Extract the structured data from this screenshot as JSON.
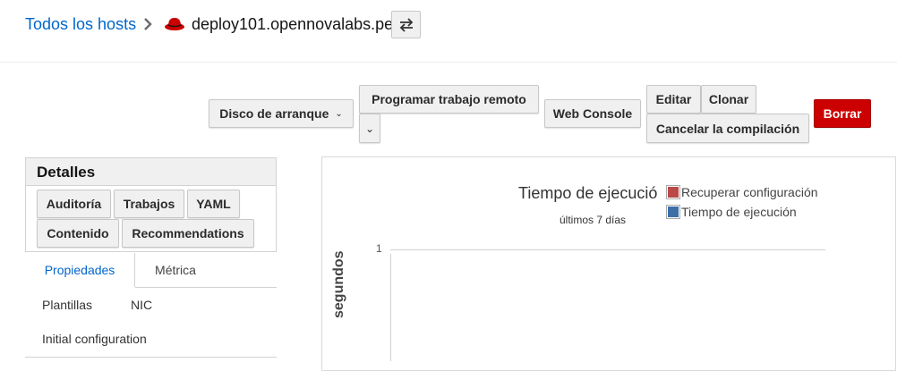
{
  "breadcrumb": {
    "all_hosts": "Todos los hosts",
    "host": "deploy101.opennovalabs.pe",
    "brand_color": "#cc0000"
  },
  "actions": {
    "boot_disk": "Disco de arranque",
    "remote_job": "Programar trabajo remoto",
    "web_console": "Web Console",
    "edit": "Editar",
    "clone": "Clonar",
    "cancel_build": "Cancelar la compilación",
    "delete": "Borrar"
  },
  "details": {
    "title": "Detalles",
    "buttons": [
      "Auditoría",
      "Trabajos",
      "YAML",
      "Contenido",
      "Recommendations"
    ],
    "tabs": [
      "Propiedades",
      "Métrica"
    ],
    "subtabs": [
      "Plantillas",
      "NIC",
      "Initial configuration"
    ]
  },
  "chart_data": {
    "type": "area",
    "title": "Tiempo de ejecució",
    "subtitle": "últimos 7 días",
    "ylabel": "segundos",
    "ytick_labels": [
      "1"
    ],
    "legend_position": "top-right",
    "series": [
      {
        "name": "Recuperar configuración",
        "color": "#b94a48",
        "values": []
      },
      {
        "name": "Tiempo de ejecución",
        "color": "#3d6fa6",
        "values": []
      }
    ]
  }
}
